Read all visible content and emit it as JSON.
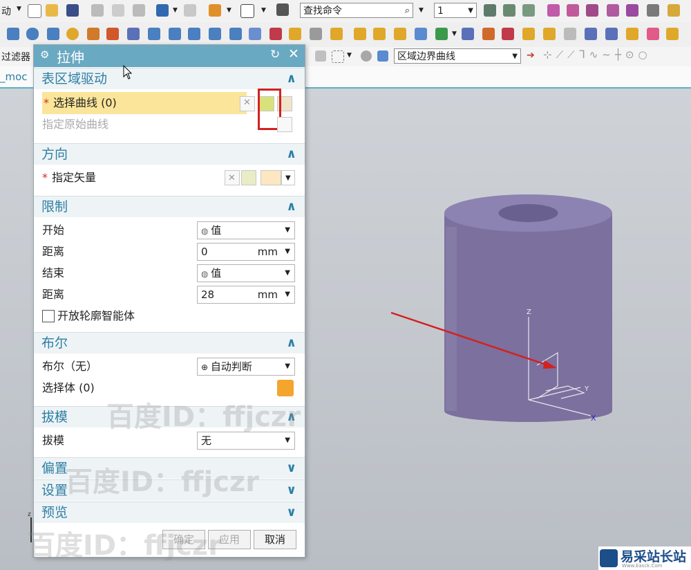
{
  "toolbar": {
    "left_label": "动",
    "search_placeholder": "查找命令",
    "layer_value": "1",
    "filter_label": "过滤器",
    "curve_rule": "区域边界曲线",
    "part_tab": "_moc"
  },
  "dialog": {
    "title": "拉伸",
    "sections": {
      "sheet": {
        "title": "表区域驱动",
        "select_curve": "选择曲线 (0)",
        "origin_curve": "指定原始曲线"
      },
      "direction": {
        "title": "方向",
        "vector": "指定矢量"
      },
      "limits": {
        "title": "限制",
        "start_label": "开始",
        "start_value": "值",
        "dist1_label": "距离",
        "dist1_value": "0",
        "dist1_unit": "mm",
        "end_label": "结束",
        "end_value": "值",
        "dist2_label": "距离",
        "dist2_value": "28",
        "dist2_unit": "mm",
        "open_profile": "开放轮廓智能体"
      },
      "boolean": {
        "title": "布尔",
        "label": "布尔（无）",
        "value": "自动判断",
        "select_body": "选择体 (0)"
      },
      "draft": {
        "title": "拔模",
        "label": "拔模",
        "value": "无"
      },
      "offset": {
        "title": "偏置"
      },
      "settings": {
        "title": "设置"
      },
      "preview": {
        "title": "预览"
      }
    },
    "buttons": {
      "ok": "确定",
      "apply": "应用",
      "cancel": "取消"
    }
  },
  "watermarks": [
    "百度ID：ffjczr",
    "百度ID：ffjczr",
    "百度ID：ffjczr"
  ],
  "triad": {
    "z": "Z",
    "y": "Y",
    "x": "X"
  },
  "brand": {
    "name": "易采站长站",
    "sub": "Www.Easck.Com"
  },
  "colors": {
    "title_bar": "#6aa9c2",
    "section_text": "#2e7fa3",
    "highlight": "#fbe59a",
    "cylinder": "#7b709e",
    "callout": "#d42020"
  }
}
